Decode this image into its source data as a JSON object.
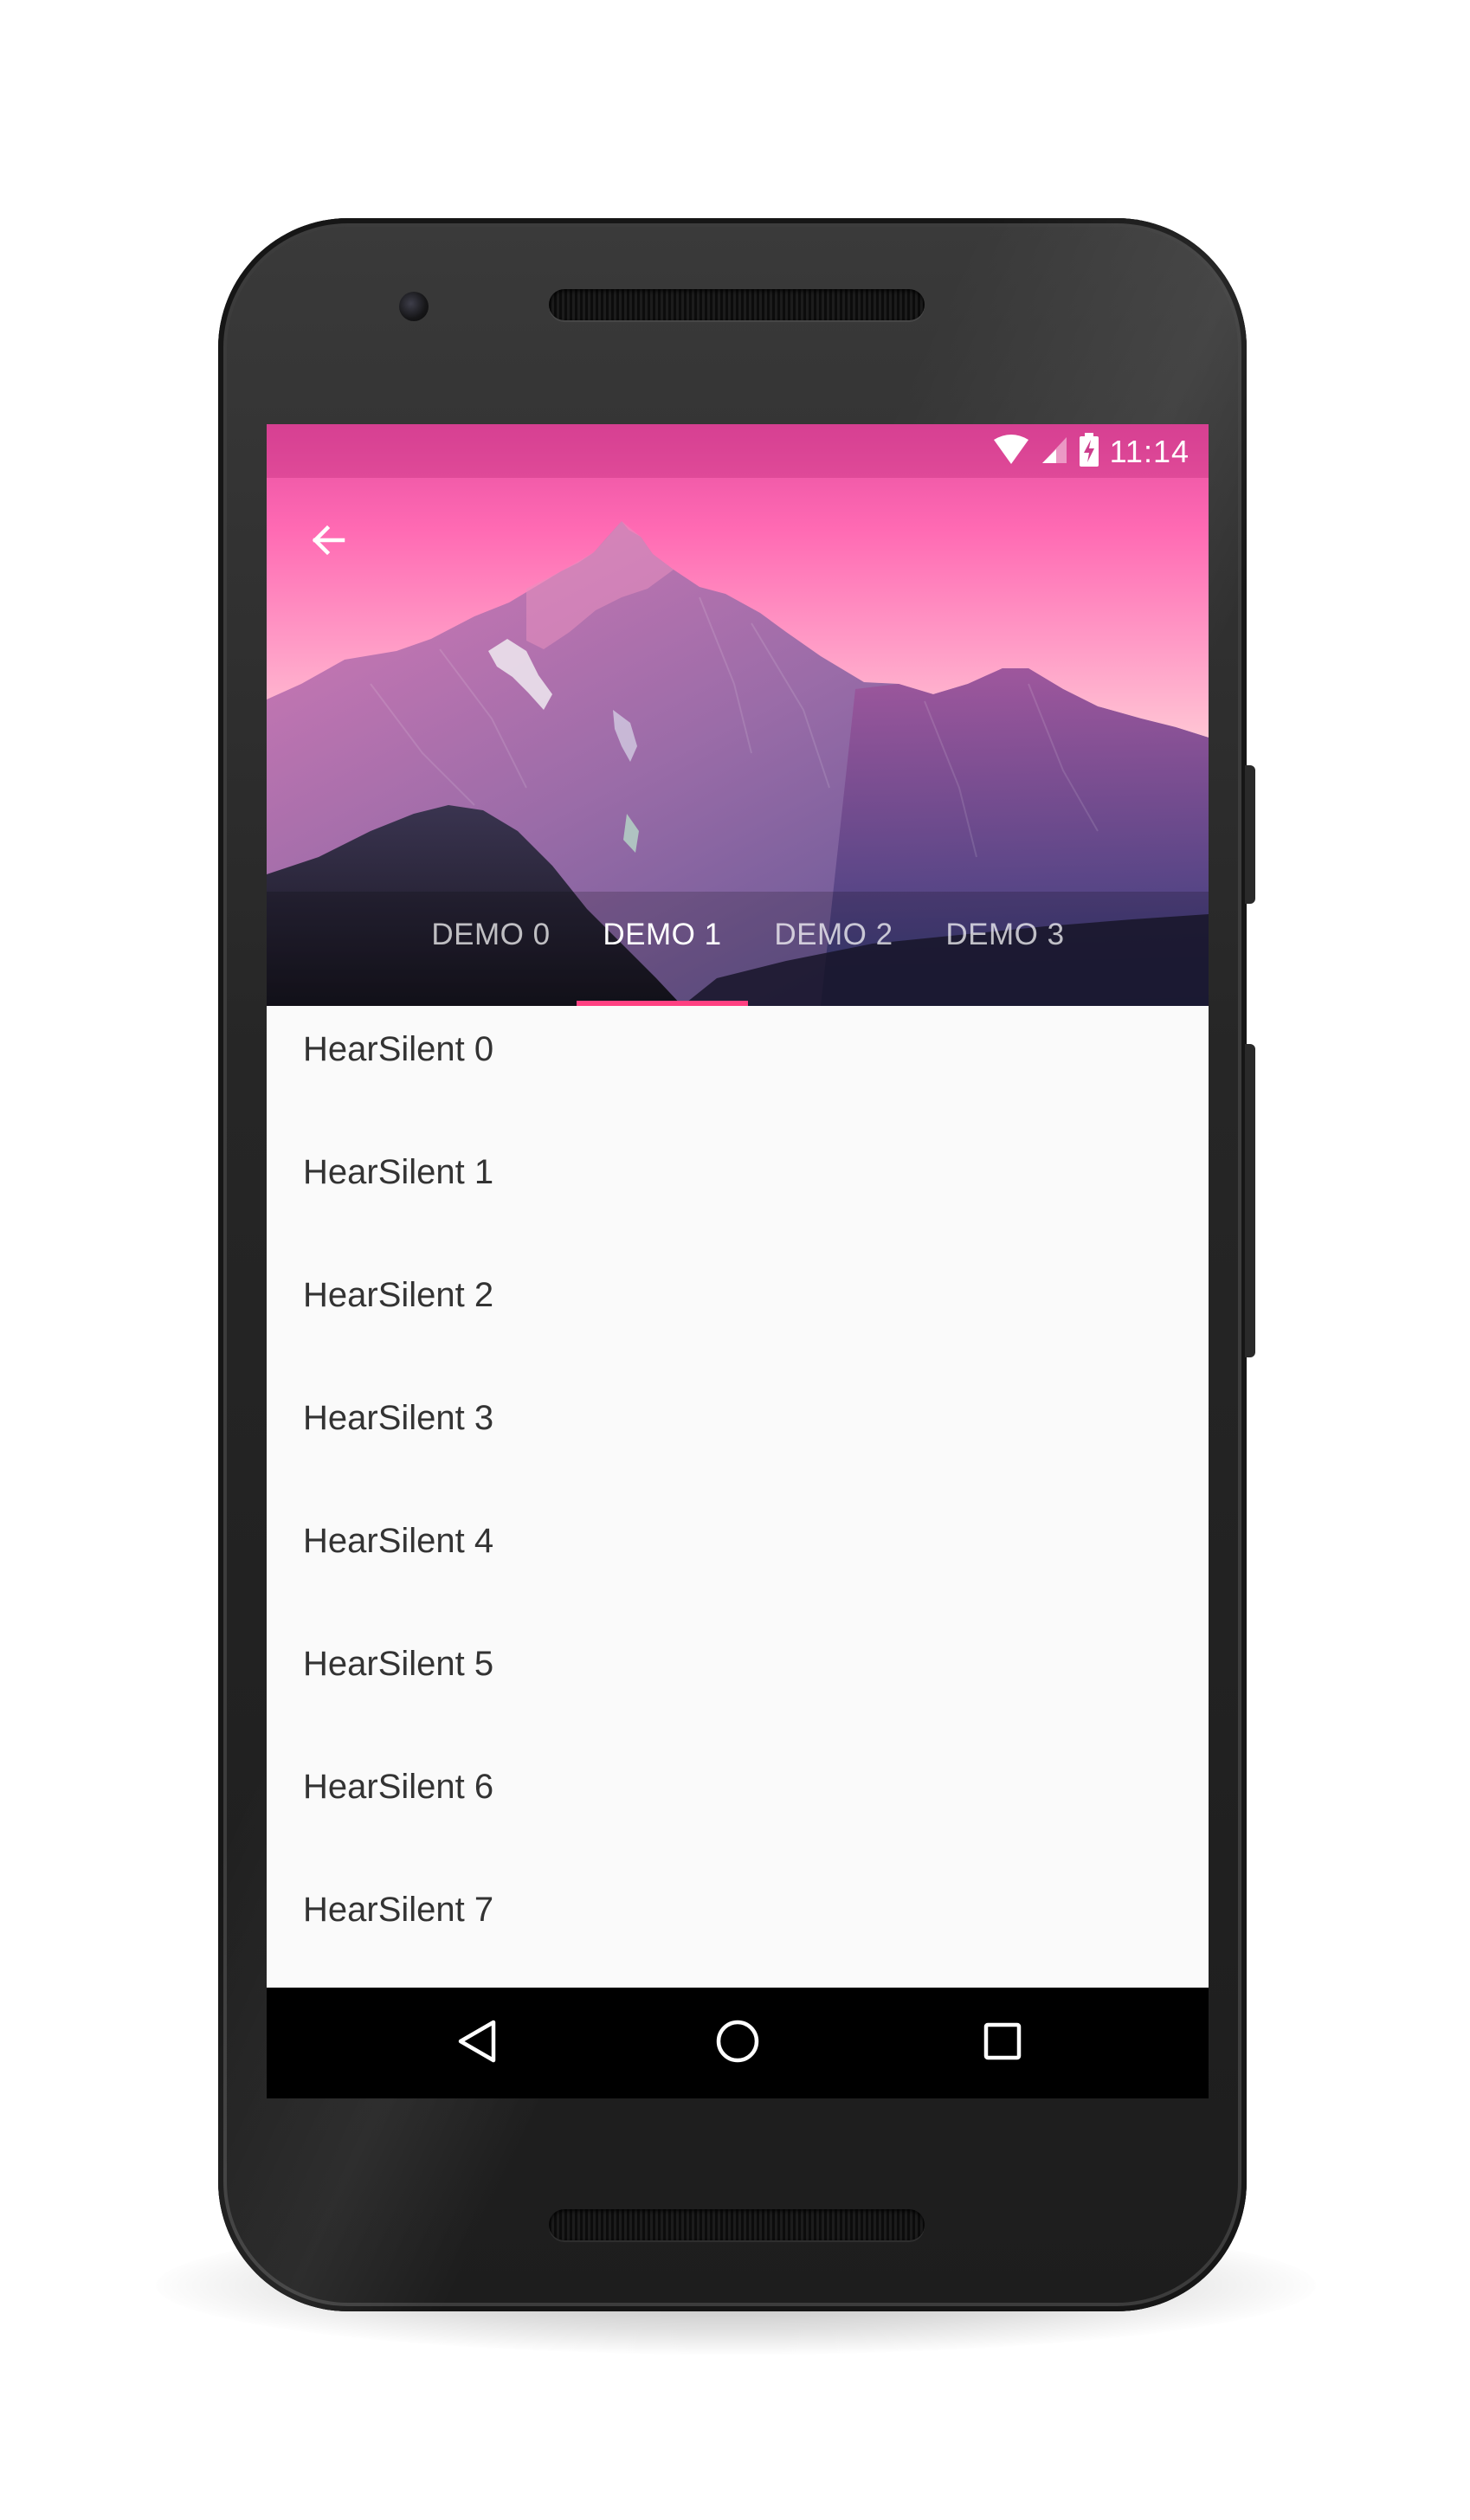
{
  "status_bar": {
    "time": "11:14",
    "wifi_icon": "wifi-icon",
    "signal_icon": "cell-signal-icon",
    "battery_icon": "battery-charging-icon"
  },
  "app_bar": {
    "back_icon": "arrow-back-icon"
  },
  "tabs": [
    {
      "label": "DEMO 0",
      "active": false
    },
    {
      "label": "DEMO 1",
      "active": true
    },
    {
      "label": "DEMO 2",
      "active": false
    },
    {
      "label": "DEMO 3",
      "active": false
    }
  ],
  "list": {
    "items": [
      "HearSilent 0",
      "HearSilent 1",
      "HearSilent 2",
      "HearSilent 3",
      "HearSilent 4",
      "HearSilent 5",
      "HearSilent 6",
      "HearSilent 7"
    ]
  },
  "nav_bar": {
    "back_icon": "triangle-back-icon",
    "home_icon": "circle-home-icon",
    "recents_icon": "square-recents-icon"
  },
  "colors": {
    "tab_indicator": "#ff4081",
    "list_background": "#fafafa",
    "list_text": "#333333",
    "nav_background": "#000000"
  }
}
